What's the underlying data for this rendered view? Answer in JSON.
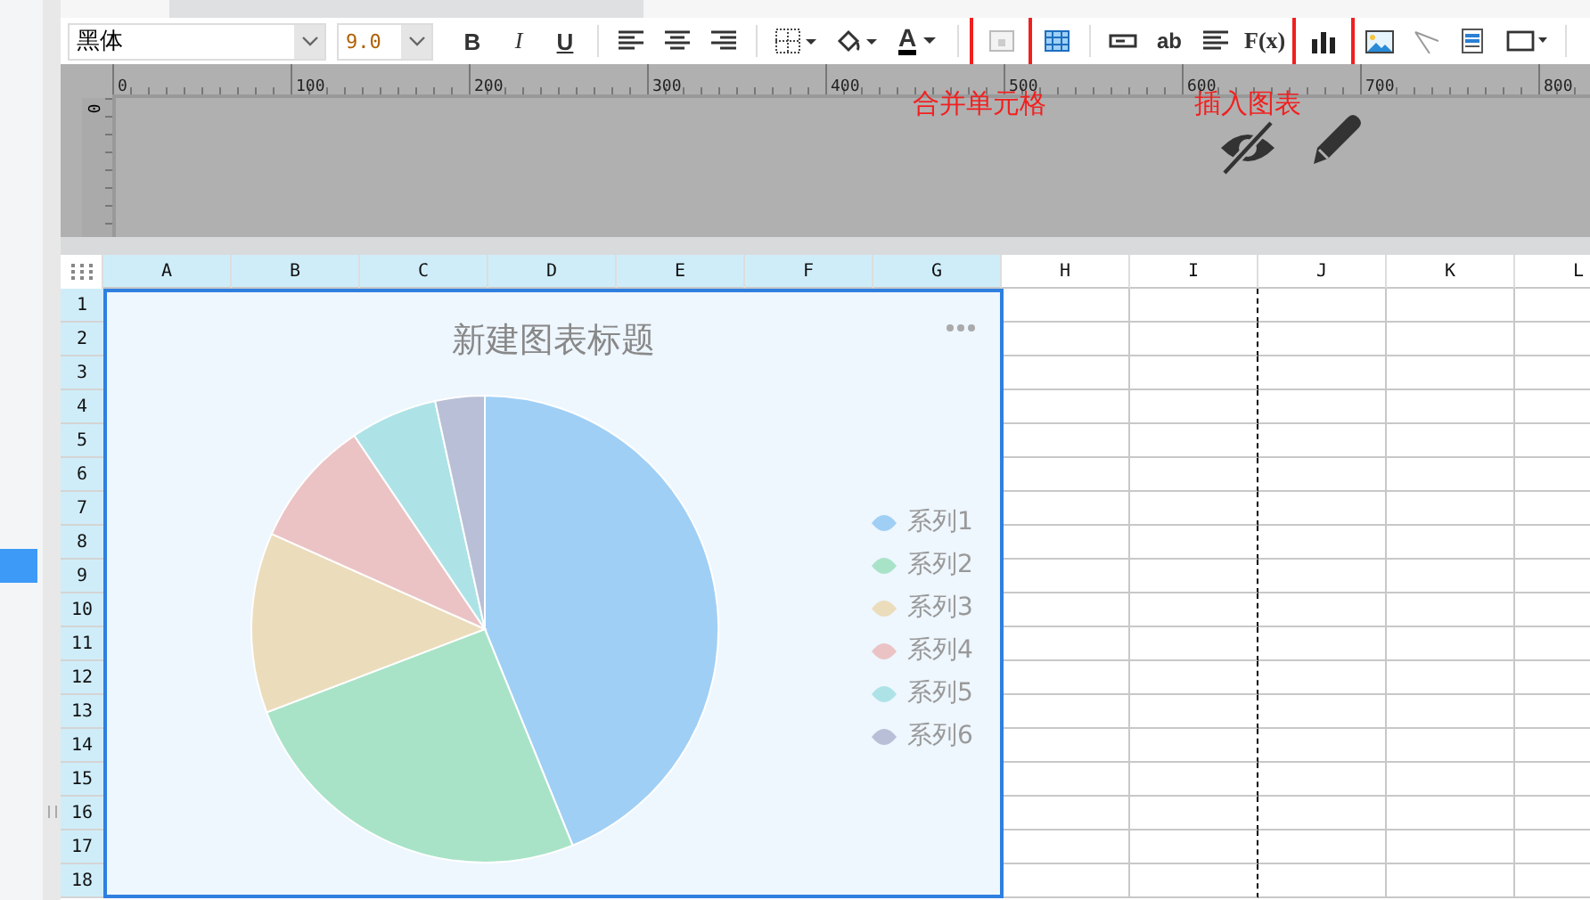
{
  "toolbar": {
    "font": {
      "value": "黑体"
    },
    "size": {
      "value": "9.0"
    },
    "bold": {
      "label": "B"
    },
    "italic": {
      "label": "I"
    },
    "underline": {
      "label": "U"
    },
    "font_color": {
      "label": "A"
    },
    "merge_cells": {
      "highlighted": true
    },
    "text": {
      "label": "ab"
    },
    "formula": {
      "label": "F(x)"
    },
    "insert_chart": {
      "highlighted": true
    }
  },
  "annotations": [
    {
      "text": "合并单元格"
    },
    {
      "text": "插入图表"
    }
  ],
  "ruler": {
    "labels": [
      "0",
      "100",
      "200",
      "300",
      "400",
      "500",
      "600",
      "700",
      "800"
    ],
    "vertical_label": "0"
  },
  "columns": [
    {
      "label": "A",
      "selected": true,
      "page_break": false
    },
    {
      "label": "B",
      "selected": true,
      "page_break": false
    },
    {
      "label": "C",
      "selected": true,
      "page_break": false
    },
    {
      "label": "D",
      "selected": true,
      "page_break": false
    },
    {
      "label": "E",
      "selected": true,
      "page_break": false
    },
    {
      "label": "F",
      "selected": true,
      "page_break": false
    },
    {
      "label": "G",
      "selected": true,
      "page_break": false
    },
    {
      "label": "H",
      "selected": false,
      "page_break": false
    },
    {
      "label": "I",
      "selected": false,
      "page_break": true
    },
    {
      "label": "J",
      "selected": false,
      "page_break": false
    },
    {
      "label": "K",
      "selected": false,
      "page_break": false
    },
    {
      "label": "L",
      "selected": false,
      "page_break": false
    }
  ],
  "rows": [
    {
      "label": "1",
      "selected": true
    },
    {
      "label": "2",
      "selected": true
    },
    {
      "label": "3",
      "selected": true
    },
    {
      "label": "4",
      "selected": true
    },
    {
      "label": "5",
      "selected": true
    },
    {
      "label": "6",
      "selected": true
    },
    {
      "label": "7",
      "selected": true
    },
    {
      "label": "8",
      "selected": true
    },
    {
      "label": "9",
      "selected": true
    },
    {
      "label": "10",
      "selected": true
    },
    {
      "label": "11",
      "selected": true
    },
    {
      "label": "12",
      "selected": true
    },
    {
      "label": "13",
      "selected": true
    },
    {
      "label": "14",
      "selected": true
    },
    {
      "label": "15",
      "selected": true
    },
    {
      "label": "16",
      "selected": true
    },
    {
      "label": "17",
      "selected": true
    },
    {
      "label": "18",
      "selected": true
    }
  ],
  "chart": {
    "title": "新建图表标题",
    "legend": [
      {
        "label": "系列1",
        "color": "#a0cff5"
      },
      {
        "label": "系列2",
        "color": "#a8e3c8"
      },
      {
        "label": "系列3",
        "color": "#ebdcbc"
      },
      {
        "label": "系列4",
        "color": "#ebc3c5"
      },
      {
        "label": "系列5",
        "color": "#ade3e6"
      },
      {
        "label": "系列6",
        "color": "#b8bfd6"
      }
    ]
  }
}
